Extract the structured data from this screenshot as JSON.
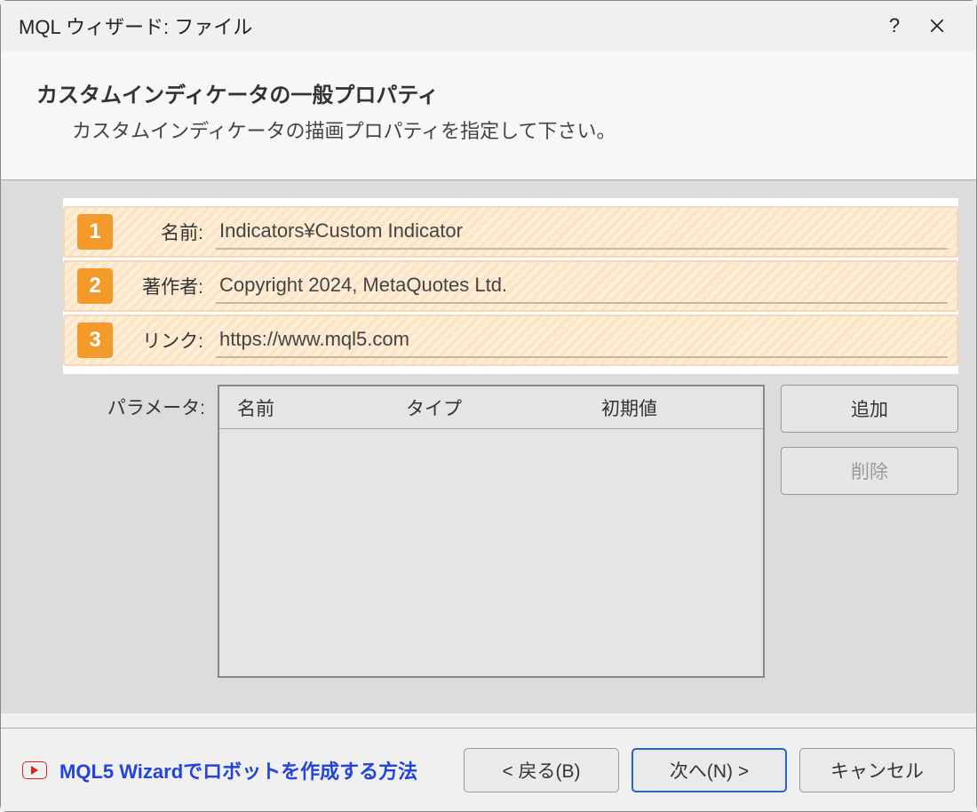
{
  "titlebar": {
    "title": "MQL ウィザード: ファイル"
  },
  "header": {
    "title": "カスタムインディケータの一般プロパティ",
    "subtitle": "カスタムインディケータの描画プロパティを指定して下さい。"
  },
  "fields": {
    "badges": [
      "1",
      "2",
      "3"
    ],
    "name_label": "名前:",
    "name_value": "Indicators¥Custom Indicator",
    "author_label": "著作者:",
    "author_value": "Copyright 2024, MetaQuotes Ltd.",
    "link_label": "リンク:",
    "link_value": "https://www.mql5.com"
  },
  "params": {
    "label": "パラメータ:",
    "columns": {
      "name": "名前",
      "type": "タイプ",
      "initial": "初期値"
    },
    "buttons": {
      "add": "追加",
      "remove": "削除"
    }
  },
  "footer": {
    "link_text": "MQL5 Wizardでロボットを作成する方法",
    "back": "< 戻る(B)",
    "next": "次へ(N) >",
    "cancel": "キャンセル"
  }
}
